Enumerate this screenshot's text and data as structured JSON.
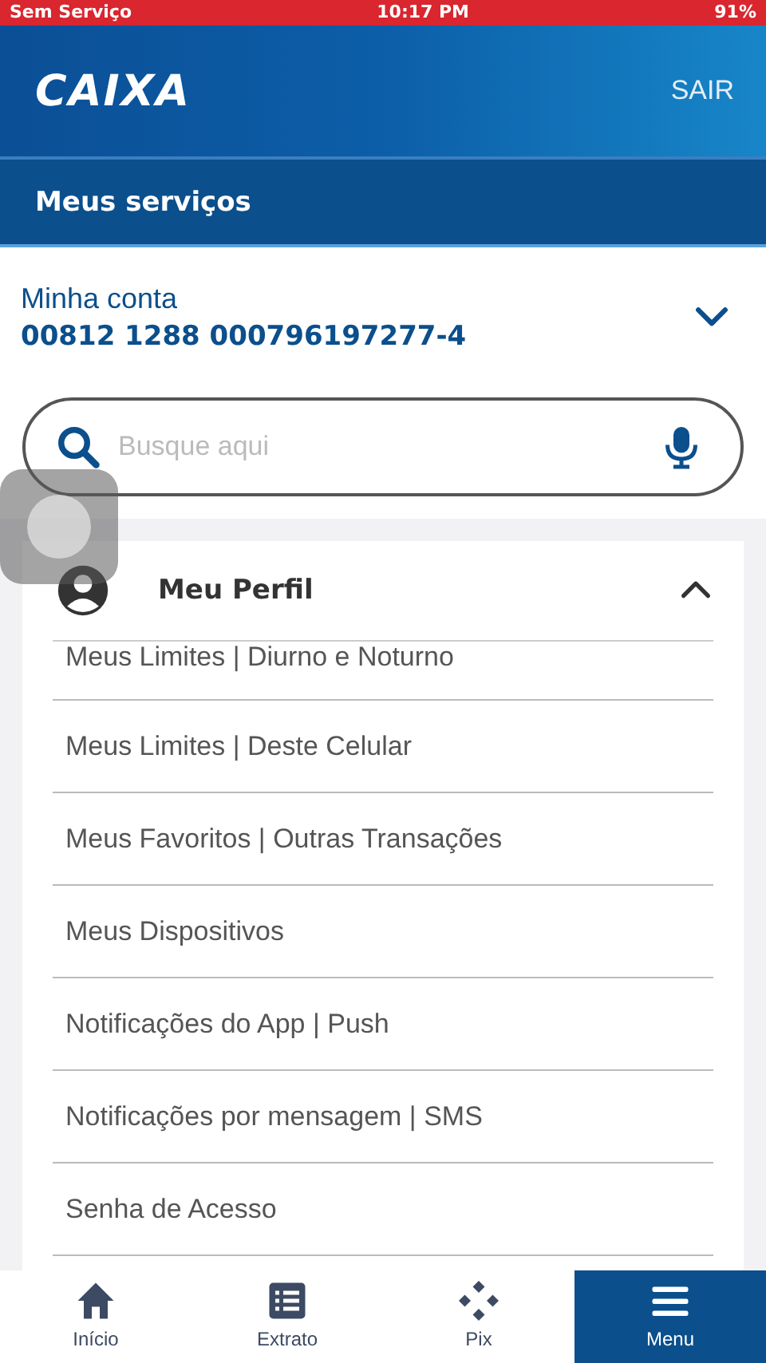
{
  "status_bar": {
    "carrier": "Sem Serviço",
    "time": "10:17 PM",
    "battery": "91%"
  },
  "header": {
    "logo": "CAIXA",
    "action": "SAIR"
  },
  "section_title": "Meus serviços",
  "account": {
    "label": "Minha conta",
    "number": "00812 1288 000796197277-4",
    "expanded": false
  },
  "search": {
    "placeholder": "Busque aqui"
  },
  "profile": {
    "title": "Meu Perfil",
    "expanded": true,
    "items": [
      {
        "label": "Meus Limites | Diurno e Noturno"
      },
      {
        "label": "Meus Limites | Deste Celular"
      },
      {
        "label": "Meus Favoritos | Outras Transações"
      },
      {
        "label": "Meus Dispositivos"
      },
      {
        "label": "Notificações do App | Push"
      },
      {
        "label": "Notificações por mensagem | SMS"
      },
      {
        "label": "Senha de Acesso"
      }
    ]
  },
  "nav": [
    {
      "label": "Início",
      "selected": false
    },
    {
      "label": "Extrato",
      "selected": false
    },
    {
      "label": "Pix",
      "selected": false
    },
    {
      "label": "Menu",
      "selected": true
    }
  ]
}
